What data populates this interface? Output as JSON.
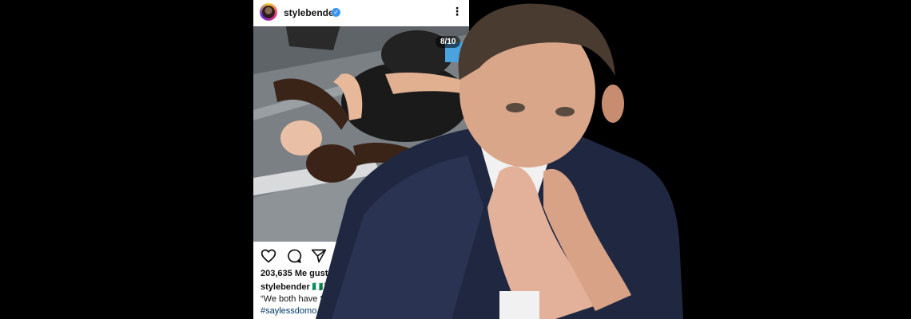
{
  "post": {
    "username": "stylebender",
    "slide_counter": "8/10",
    "likes_text": "203,635 Me gust",
    "caption_user": "stylebender 🇳🇬⚔",
    "caption_text": "“We both have S",
    "hashtag": "#saylessdomo",
    "icons": [
      "heart-icon",
      "comment-icon",
      "share-icon",
      "more-options-icon",
      "verified-badge-icon"
    ]
  }
}
